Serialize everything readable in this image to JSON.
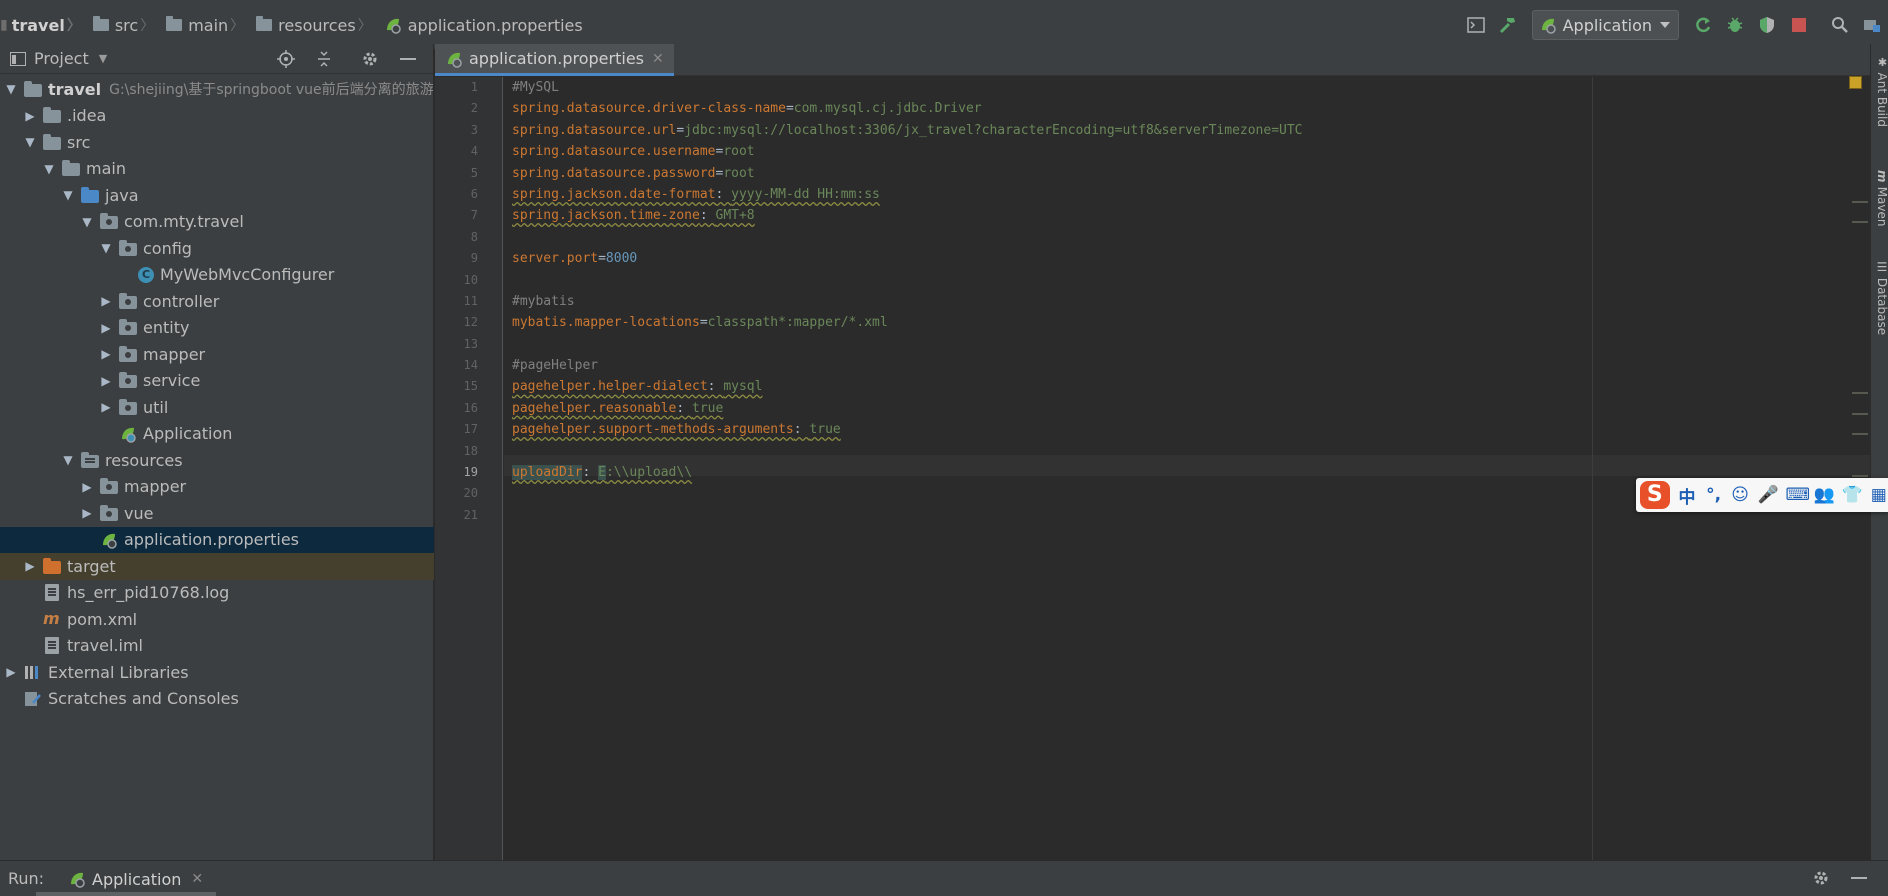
{
  "breadcrumb": [
    {
      "label": "travel",
      "icon": "module-icon"
    },
    {
      "label": "src",
      "icon": "folder-icon"
    },
    {
      "label": "main",
      "icon": "folder-icon"
    },
    {
      "label": "resources",
      "icon": "resources-folder-icon"
    },
    {
      "label": "application.properties",
      "icon": "spring-properties-icon"
    }
  ],
  "toolbar": {
    "run_config": "Application"
  },
  "project_panel": {
    "title": "Project",
    "tree": [
      {
        "label": "travel",
        "path": "G:\\shejiing\\基于springboot vue前后端分离的旅游",
        "depth": 0,
        "expanded": true,
        "icon": "module",
        "bold": true
      },
      {
        "label": ".idea",
        "depth": 1,
        "expanded": false,
        "icon": "folder"
      },
      {
        "label": "src",
        "depth": 1,
        "expanded": true,
        "icon": "folder"
      },
      {
        "label": "main",
        "depth": 2,
        "expanded": true,
        "icon": "folder"
      },
      {
        "label": "java",
        "depth": 3,
        "expanded": true,
        "icon": "source-folder"
      },
      {
        "label": "com.mty.travel",
        "depth": 4,
        "expanded": true,
        "icon": "package"
      },
      {
        "label": "config",
        "depth": 5,
        "expanded": true,
        "icon": "package"
      },
      {
        "label": "MyWebMvcConfigurer",
        "depth": 6,
        "icon": "class"
      },
      {
        "label": "controller",
        "depth": 5,
        "expanded": false,
        "icon": "package"
      },
      {
        "label": "entity",
        "depth": 5,
        "expanded": false,
        "icon": "package"
      },
      {
        "label": "mapper",
        "depth": 5,
        "expanded": false,
        "icon": "package"
      },
      {
        "label": "service",
        "depth": 5,
        "expanded": false,
        "icon": "package"
      },
      {
        "label": "util",
        "depth": 5,
        "expanded": false,
        "icon": "package"
      },
      {
        "label": "Application",
        "depth": 5,
        "icon": "spring-class"
      },
      {
        "label": "resources",
        "depth": 3,
        "expanded": true,
        "icon": "resources-folder"
      },
      {
        "label": "mapper",
        "depth": 4,
        "expanded": false,
        "icon": "package"
      },
      {
        "label": "vue",
        "depth": 4,
        "expanded": false,
        "icon": "package"
      },
      {
        "label": "application.properties",
        "depth": 4,
        "icon": "spring-properties",
        "selected": true
      },
      {
        "label": "target",
        "depth": 1,
        "expanded": false,
        "icon": "excluded-folder",
        "excluded": true
      },
      {
        "label": "hs_err_pid10768.log",
        "depth": 1,
        "icon": "text-file"
      },
      {
        "label": "pom.xml",
        "depth": 1,
        "icon": "maven-file"
      },
      {
        "label": "travel.iml",
        "depth": 1,
        "icon": "iml-file"
      },
      {
        "label": "External Libraries",
        "depth": 0,
        "expanded": false,
        "icon": "libraries"
      },
      {
        "label": "Scratches and Consoles",
        "depth": 0,
        "icon": "scratches"
      }
    ]
  },
  "editor": {
    "tab_label": "application.properties",
    "current_line": 19,
    "lines": [
      [
        {
          "t": "#MySQL",
          "c": "c"
        }
      ],
      [
        {
          "t": "spring.datasource.driver-class-name",
          "c": "k"
        },
        {
          "t": "=",
          "c": "eq"
        },
        {
          "t": "com.mysql.cj.jdbc.Driver",
          "c": "v"
        }
      ],
      [
        {
          "t": "spring.datasource.url",
          "c": "k"
        },
        {
          "t": "=",
          "c": "eq"
        },
        {
          "t": "jdbc:mysql://localhost:3306/jx_travel?characterEncoding=utf8&serverTimezone=UTC",
          "c": "v"
        }
      ],
      [
        {
          "t": "spring.datasource.username",
          "c": "k"
        },
        {
          "t": "=",
          "c": "eq"
        },
        {
          "t": "root",
          "c": "v"
        }
      ],
      [
        {
          "t": "spring.datasource.password",
          "c": "k"
        },
        {
          "t": "=",
          "c": "eq"
        },
        {
          "t": "root",
          "c": "v"
        }
      ],
      [
        {
          "t": "spring.jackson.date-format",
          "c": "k wavy"
        },
        {
          "t": ": ",
          "c": "eq wavy"
        },
        {
          "t": "yyyy-MM-dd HH:mm:ss",
          "c": "v wavy"
        }
      ],
      [
        {
          "t": "spring.jackson.time-zone",
          "c": "k wavy"
        },
        {
          "t": ": ",
          "c": "eq wavy"
        },
        {
          "t": "GMT+8",
          "c": "v wavy"
        }
      ],
      [],
      [
        {
          "t": "server.port",
          "c": "k"
        },
        {
          "t": "=",
          "c": "eq"
        },
        {
          "t": "8000",
          "c": "n"
        }
      ],
      [],
      [
        {
          "t": "#mybatis",
          "c": "c"
        }
      ],
      [
        {
          "t": "mybatis.mapper-locations",
          "c": "k"
        },
        {
          "t": "=",
          "c": "eq"
        },
        {
          "t": "classpath*:mapper/*.xml",
          "c": "v"
        }
      ],
      [],
      [
        {
          "t": "#pageHelper",
          "c": "c"
        }
      ],
      [
        {
          "t": "pagehelper.helper-dialect",
          "c": "k wavy"
        },
        {
          "t": ": ",
          "c": "eq wavy"
        },
        {
          "t": "mysql",
          "c": "v wavy"
        }
      ],
      [
        {
          "t": "pagehelper.reasonable",
          "c": "k wavy"
        },
        {
          "t": ": ",
          "c": "eq wavy"
        },
        {
          "t": "true",
          "c": "v wavy"
        }
      ],
      [
        {
          "t": "pagehelper.support-methods-arguments",
          "c": "k wavy"
        },
        {
          "t": ": ",
          "c": "eq wavy"
        },
        {
          "t": "true",
          "c": "v wavy"
        }
      ],
      [],
      [
        {
          "t": "uploadDir",
          "c": "k wavy hl"
        },
        {
          "t": ": ",
          "c": "eq wavy"
        },
        {
          "t": "E",
          "c": "v wavy hl"
        },
        {
          "t": ":\\\\upload\\\\",
          "c": "v wavy"
        }
      ],
      [],
      []
    ]
  },
  "right_tool_windows": [
    "Ant Build",
    "Maven",
    "Database"
  ],
  "ime_bar": {
    "logo": "S",
    "items": [
      "中",
      "°,",
      "☺",
      "🎤",
      "⌨",
      "👥",
      "👕",
      "▦"
    ]
  },
  "run_bar": {
    "label": "Run:",
    "tab_label": "Application"
  },
  "colors": {
    "keyword": "#cc7832",
    "value": "#6a8759",
    "comment": "#808080",
    "number": "#6897bb",
    "selection": "#0d293e",
    "accent": "#4a88c7"
  }
}
